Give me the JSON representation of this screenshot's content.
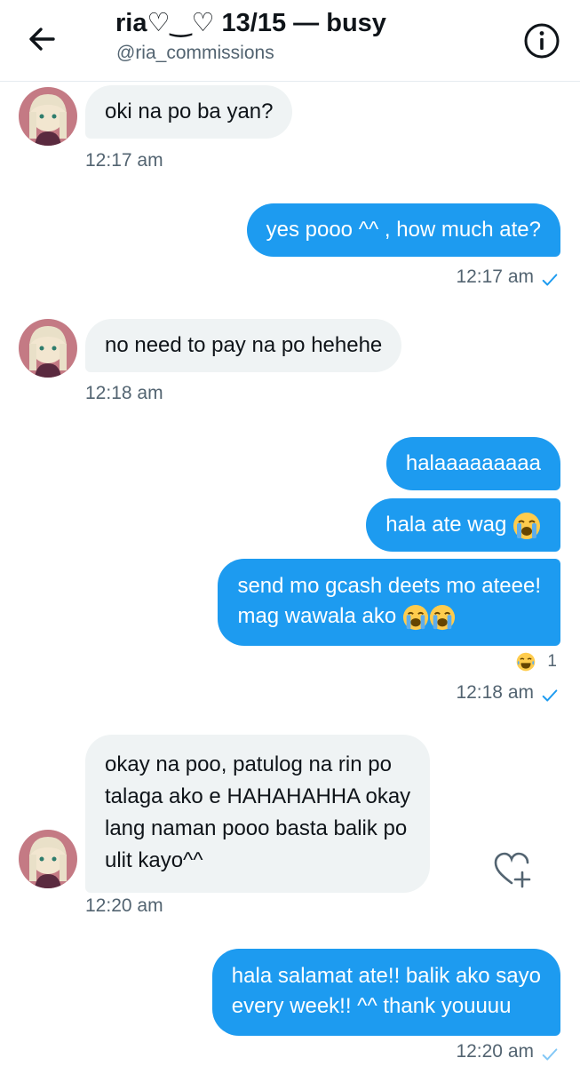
{
  "header": {
    "title": "ria♡‿♡ 13/15 — busy",
    "handle": "@ria_commissions"
  },
  "messages": [
    {
      "text": "oki na po ba yan?",
      "time": "12:17 am"
    },
    {
      "text": "yes pooo ^^ , how much ate?",
      "time": "12:17 am"
    },
    {
      "text": "no need to pay na po hehehe",
      "time": "12:18 am"
    },
    {
      "text": "halaaaaaaaaa"
    },
    {
      "text": "hala ate wag"
    },
    {
      "line1": "send mo gcash deets mo ateee!",
      "line2": "mag wawala ako",
      "reaction_count": "1",
      "time": "12:18 am"
    },
    {
      "line1": "okay na poo, patulog na rin po",
      "line2": "talaga ako e HAHAHAHHA okay",
      "line3": "lang naman pooo basta balik po",
      "line4": "ulit kayo^^",
      "time": "12:20 am"
    },
    {
      "line1": "hala salamat ate!! balik ako sayo",
      "line2": "every week!! ^^ thank youuuu",
      "time": "12:20 am"
    }
  ],
  "icons": {
    "back": "arrow-left-icon",
    "info": "info-circle-icon",
    "react": "heart-plus-icon",
    "read": "checkmark-icon",
    "emoji_cry": "loudly-crying-face",
    "emoji_laugh": "tears-of-joy-face"
  },
  "colors": {
    "accent": "#1d9bf0",
    "received_bubble": "#eff3f4",
    "secondary_text": "#536471"
  }
}
